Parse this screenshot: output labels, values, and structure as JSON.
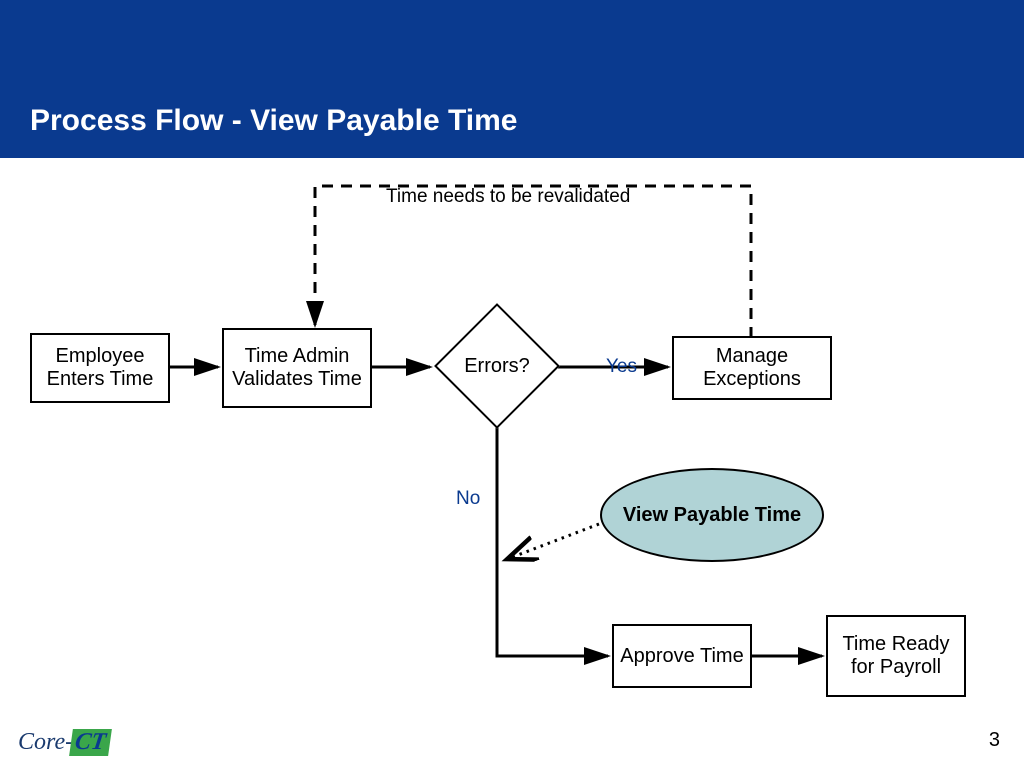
{
  "header": {
    "title": "Process Flow - View Payable Time"
  },
  "nodes": {
    "employee_enters_time": "Employee Enters Time",
    "time_admin_validates": "Time Admin Validates Time",
    "errors_decision": "Errors?",
    "manage_exceptions": "Manage Exceptions",
    "view_payable_time": "View Payable Time",
    "approve_time": "Approve Time",
    "time_ready_payroll": "Time Ready for Payroll"
  },
  "labels": {
    "revalidate": "Time needs to be revalidated",
    "yes": "Yes",
    "no": "No"
  },
  "footer": {
    "logo_left": "Core-",
    "logo_right": "CT",
    "page_number": "3"
  }
}
